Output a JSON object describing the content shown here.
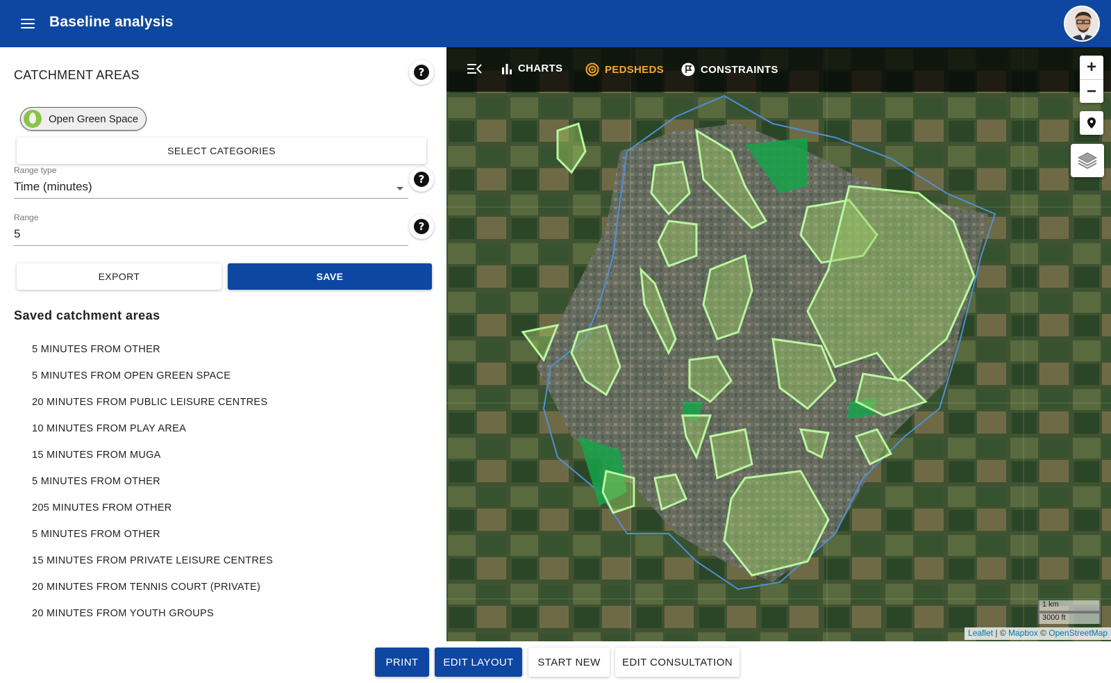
{
  "app": {
    "title": "Baseline analysis"
  },
  "panel": {
    "title": "CATCHMENT AREAS",
    "chip_label": "Open Green Space",
    "select_categories": "SELECT CATEGORIES",
    "range_type_label": "Range type",
    "range_type_value": "Time (minutes)",
    "range_label": "Range",
    "range_value": "5",
    "export_label": "EXPORT",
    "save_label": "SAVE",
    "saved_title": "Saved catchment areas",
    "saved_items": [
      "5 MINUTES FROM OTHER",
      "5 MINUTES FROM OPEN GREEN SPACE",
      "20 MINUTES FROM PUBLIC LEISURE CENTRES",
      "10 MINUTES FROM PLAY AREA",
      "15 MINUTES FROM MUGA",
      "5 MINUTES FROM OTHER",
      "205 MINUTES FROM OTHER",
      "5 MINUTES FROM OTHER",
      "15 MINUTES FROM PRIVATE LEISURE CENTRES",
      "20 MINUTES FROM TENNIS COURT (PRIVATE)",
      "20 MINUTES FROM YOUTH GROUPS"
    ]
  },
  "map": {
    "toolbar": {
      "charts": "CHARTS",
      "pedsheds": "PEDSHEDS",
      "constraints": "CONSTRAINTS"
    },
    "zoom_in": "+",
    "zoom_out": "−",
    "scale_km": "1 km",
    "scale_ft": "3000 ft",
    "attribution": {
      "leaflet": "Leaflet",
      "sep1": " | © ",
      "mapbox": "Mapbox",
      "sep2": " © ",
      "osm": "OpenStreetMap"
    }
  },
  "footer": {
    "print": "PRINT",
    "edit_layout": "EDIT LAYOUT",
    "start_new": "START NEW",
    "edit_consultation": "EDIT CONSULTATION"
  },
  "colors": {
    "primary": "#0d47a1",
    "active_tab": "#f9a825",
    "catchment_fill": "#9ccc65",
    "catchment_stroke": "#b9f6a0",
    "boundary": "#4f8fd8"
  }
}
